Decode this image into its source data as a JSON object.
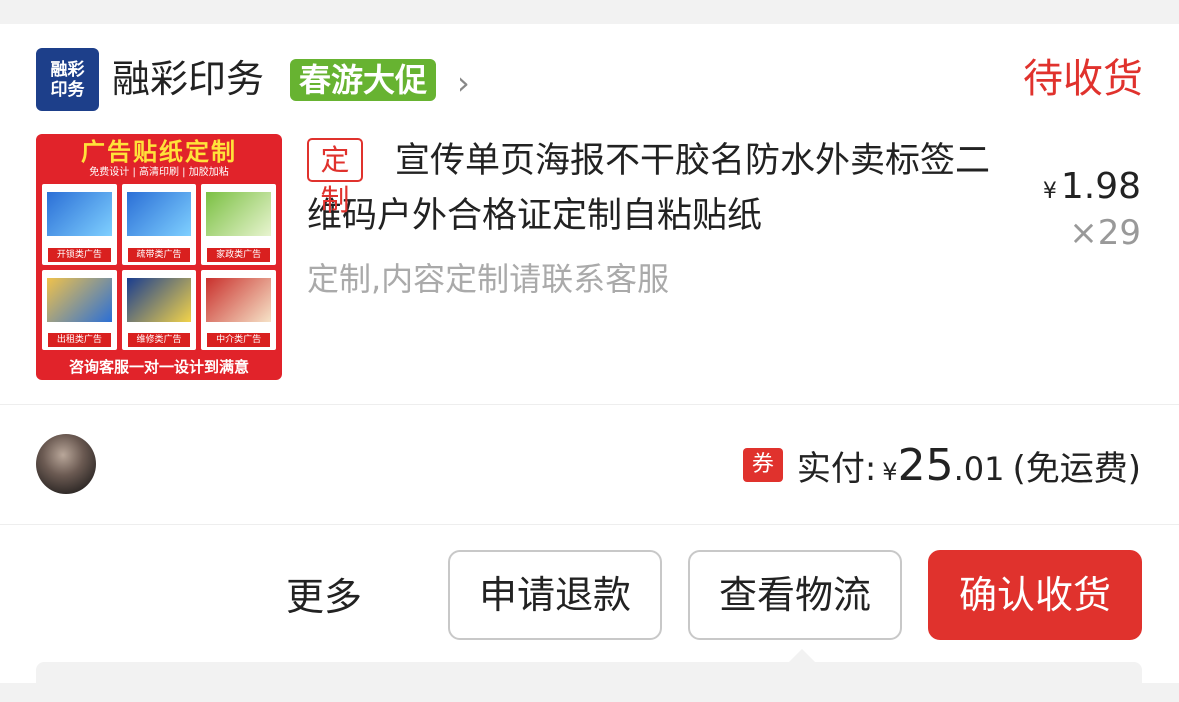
{
  "shop": {
    "logo_text": "融彩\n印务",
    "name": "融彩印务",
    "promo": "春游大促"
  },
  "order": {
    "status": "待收货"
  },
  "product": {
    "tag": "定制",
    "title": "宣传单页海报不干胶名防水外卖标签二维码户外合格证定制自粘贴纸",
    "spec": "定制,内容定制请联系客服",
    "price": "1.98",
    "currency": "¥",
    "quantity": "×29",
    "image": {
      "title": "广告贴纸定制",
      "subtitle": "免费设计 | 高清印刷 | 加胶加粘",
      "categories": [
        "开锁类广告",
        "疏带类广告",
        "家政类广告",
        "出租类广告",
        "维修类广告",
        "中介类广告"
      ],
      "footer": "咨询客服一对一设计到满意"
    }
  },
  "payment": {
    "coupon_icon": "券",
    "label": "实付:",
    "currency": "¥",
    "amount_int": "25",
    "amount_dec": ".01",
    "shipping": "(免运费)"
  },
  "actions": {
    "more": "更多",
    "refund": "申请退款",
    "logistics": "查看物流",
    "confirm": "确认收货"
  },
  "colors": {
    "accent": "#e0322d",
    "promo": "#67b331"
  }
}
